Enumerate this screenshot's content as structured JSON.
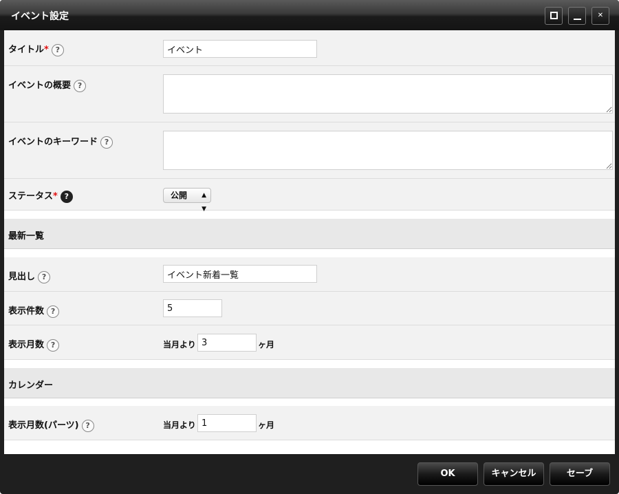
{
  "window": {
    "title": "イベント設定",
    "buttons": {
      "maximize": "maximize-icon",
      "minimize": "minimize-icon",
      "close": "close-icon"
    }
  },
  "form": {
    "title_label": "タイトル",
    "title_required": "*",
    "title_value": "イベント",
    "summary_label": "イベントの概要",
    "summary_value": "",
    "keyword_label": "イベントのキーワード",
    "keyword_value": "",
    "status_label": "ステータス",
    "status_required": "*",
    "status_value": "公開",
    "help_glyph": "?"
  },
  "section_latest": {
    "label": "最新一覧",
    "heading_label": "見出し",
    "heading_value": "イベント新着一覧",
    "count_label": "表示件数",
    "count_value": "5",
    "months_label": "表示月数",
    "months_prefix": "当月より",
    "months_value": "3",
    "months_suffix": "ヶ月"
  },
  "section_calendar": {
    "label": "カレンダー",
    "months_label": "表示月数(パーツ)",
    "months_prefix": "当月より",
    "months_value": "1",
    "months_suffix": "ヶ月"
  },
  "footer": {
    "ok": "OK",
    "cancel": "キャンセル",
    "save": "セーブ"
  }
}
